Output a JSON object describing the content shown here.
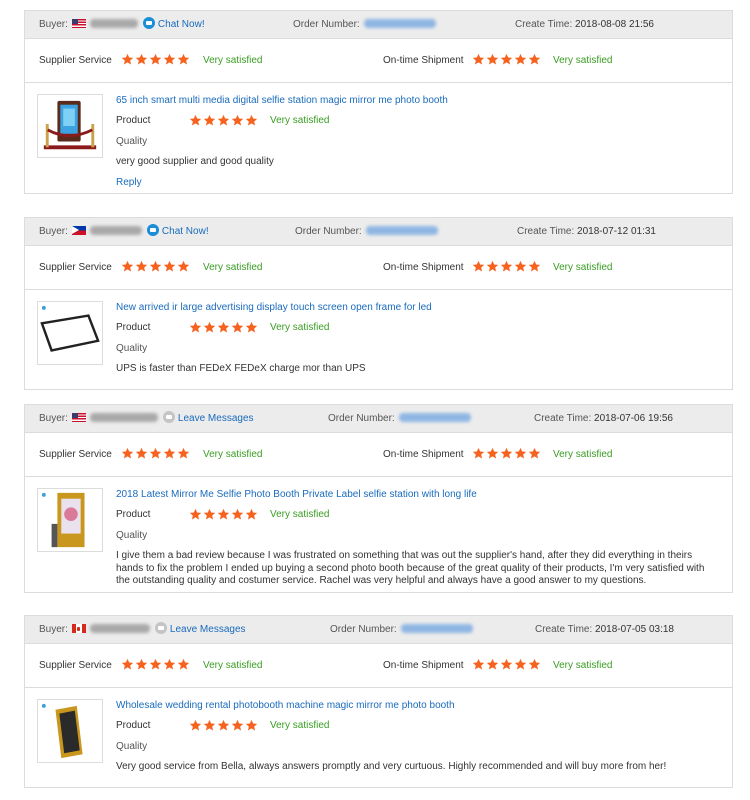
{
  "labels": {
    "buyer": "Buyer:",
    "order_number": "Order Number:",
    "create_time": "Create Time:",
    "supplier_service": "Supplier Service",
    "ontime_shipment": "On-time Shipment",
    "product": "Product",
    "quality": "Quality",
    "reply": "Reply"
  },
  "colors": {
    "star": "#f5631f",
    "satisfied": "#3a9d23",
    "link": "#1a6bbd"
  },
  "reviews": [
    {
      "flag": "us-flag-icon",
      "contact_icon": "chat-icon",
      "contact_label": "Chat Now!",
      "create_time": "2018-08-08 21:56",
      "supplier_service": {
        "stars": 5,
        "text": "Very satisfied"
      },
      "ontime_shipment": {
        "stars": 5,
        "text": "Very satisfied"
      },
      "product_icon": "magic-mirror-booth-image",
      "product_title": "65 inch smart multi media digital selfie station magic mirror me photo booth",
      "product_quality": {
        "stars": 5,
        "text": "Very satisfied"
      },
      "comment": "very good supplier and good quality",
      "has_reply": true
    },
    {
      "flag": "ph-flag-icon",
      "contact_icon": "chat-icon",
      "contact_label": "Chat Now!",
      "create_time": "2018-07-12 01:31",
      "supplier_service": {
        "stars": 5,
        "text": "Very satisfied"
      },
      "ontime_shipment": {
        "stars": 5,
        "text": "Very satisfied"
      },
      "product_icon": "touch-frame-image",
      "product_title": "New arrived ir large advertising display touch screen open frame for led",
      "product_quality": {
        "stars": 5,
        "text": "Very satisfied"
      },
      "comment": "UPS is faster than FEDeX FEDeX charge mor than UPS",
      "has_reply": false
    },
    {
      "flag": "us-flag-icon",
      "contact_icon": "message-icon",
      "contact_label": "Leave Messages",
      "create_time": "2018-07-06 19:56",
      "supplier_service": {
        "stars": 5,
        "text": "Very satisfied"
      },
      "ontime_shipment": {
        "stars": 5,
        "text": "Very satisfied"
      },
      "product_icon": "mirror-booth-image",
      "product_title": "2018 Latest Mirror Me Selfie Photo Booth Private Label selfie station with long life",
      "product_quality": {
        "stars": 5,
        "text": "Very satisfied"
      },
      "comment": "I give them a bad review because I was frustrated on something that was out the supplier's hand, after they did everything in theirs hands to fix the problem I ended up buying a second photo booth because of the great quality of their products, I'm very satisfied with the outstanding quality and costumer service. Rachel was very helpful and always have a good answer to my questions.",
      "has_reply": false
    },
    {
      "flag": "ca-flag-icon",
      "contact_icon": "message-icon",
      "contact_label": "Leave Messages",
      "create_time": "2018-07-05 03:18",
      "supplier_service": {
        "stars": 5,
        "text": "Very satisfied"
      },
      "ontime_shipment": {
        "stars": 5,
        "text": "Very satisfied"
      },
      "product_icon": "gold-mirror-booth-image",
      "product_title": "Wholesale wedding rental photobooth machine magic mirror me photo booth",
      "product_quality": {
        "stars": 5,
        "text": "Very satisfied"
      },
      "comment": "Very good service from Bella, always answers promptly and very curtuous. Highly recommended and will buy more from her!",
      "has_reply": false
    }
  ]
}
